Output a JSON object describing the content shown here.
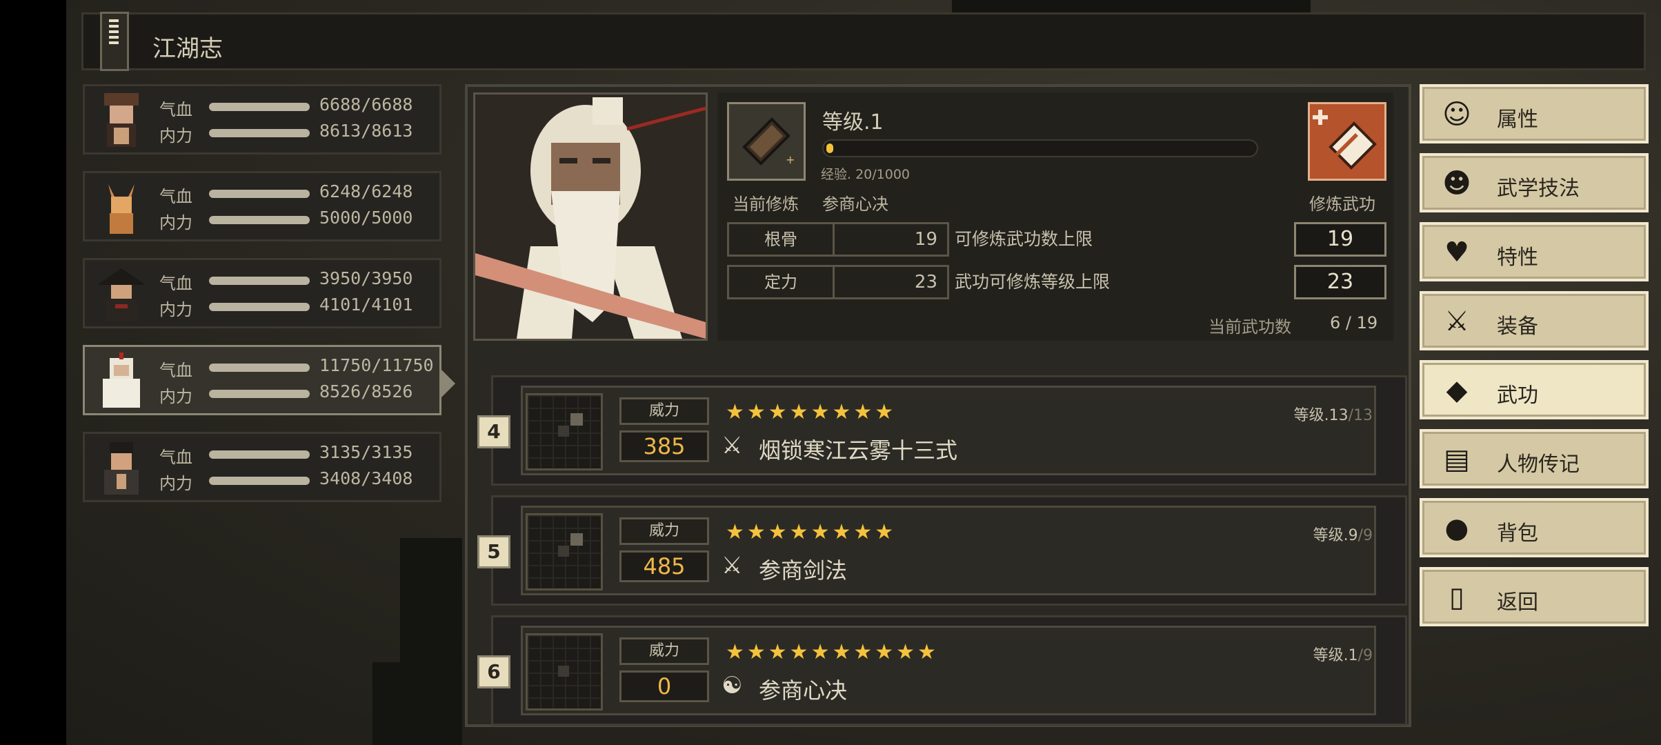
{
  "title": "江湖志",
  "party": [
    {
      "hp_label": "气血",
      "hp": "6688/6688",
      "mp_label": "内力",
      "mp": "8613/8613",
      "selected": false,
      "hp_fraction": 1,
      "mp_fraction": 1
    },
    {
      "hp_label": "气血",
      "hp": "6248/6248",
      "mp_label": "内力",
      "mp": "5000/5000",
      "selected": false,
      "hp_fraction": 1,
      "mp_fraction": 1
    },
    {
      "hp_label": "气血",
      "hp": "3950/3950",
      "mp_label": "内力",
      "mp": "4101/4101",
      "selected": false,
      "hp_fraction": 1,
      "mp_fraction": 1
    },
    {
      "hp_label": "气血",
      "hp": "11750/11750",
      "mp_label": "内力",
      "mp": "8526/8526",
      "selected": true,
      "hp_fraction": 1,
      "mp_fraction": 1
    },
    {
      "hp_label": "气血",
      "hp": "3135/3135",
      "mp_label": "内力",
      "mp": "3408/3408",
      "selected": false,
      "hp_fraction": 1,
      "mp_fraction": 1
    }
  ],
  "cultivation": {
    "level": "等级.1",
    "exp": "经验. 20/1000",
    "exp_fraction": 0.02,
    "current_label": "当前修炼",
    "current_value": "参商心决",
    "train_label": "修炼武功",
    "stats": [
      {
        "name": "根骨",
        "value": "19",
        "desc": "可修炼武功数上限",
        "limit": "19"
      },
      {
        "name": "定力",
        "value": "23",
        "desc": "武功可修炼等级上限",
        "limit": "23"
      }
    ],
    "count_label": "当前武功数",
    "count_value": "6 / 19"
  },
  "skills": [
    {
      "index": "4",
      "power_label": "威力",
      "power": "385",
      "stars": "★★★★★★★★",
      "level": "等级.13",
      "level_max": "/13",
      "icon": "sword-icon",
      "name": "烟锁寒江云雾十三式"
    },
    {
      "index": "5",
      "power_label": "威力",
      "power": "485",
      "stars": "★★★★★★★★",
      "level": "等级.9",
      "level_max": "/9",
      "icon": "sword-icon",
      "name": "参商剑法"
    },
    {
      "index": "6",
      "power_label": "威力",
      "power": "0",
      "stars": "★★★★★★★★★★",
      "level": "等级.1",
      "level_max": "/9",
      "icon": "yin-yang-icon",
      "name": "参商心决"
    }
  ],
  "menu": [
    {
      "label": "属性",
      "icon": "person-icon",
      "active": false
    },
    {
      "label": "武学技法",
      "icon": "technique-icon",
      "active": false
    },
    {
      "label": "特性",
      "icon": "trait-icon",
      "active": false
    },
    {
      "label": "装备",
      "icon": "sword-icon",
      "active": false
    },
    {
      "label": "武功",
      "icon": "book-icon",
      "active": true
    },
    {
      "label": "人物传记",
      "icon": "scroll-icon",
      "active": false
    },
    {
      "label": "背包",
      "icon": "bag-icon",
      "active": false
    },
    {
      "label": "返回",
      "icon": "door-icon",
      "active": false
    }
  ],
  "colors": {
    "accent": "#f4c23c",
    "power": "#f0b84a",
    "menu_bg": "#d5c9a5",
    "panel": "#2a2823"
  }
}
